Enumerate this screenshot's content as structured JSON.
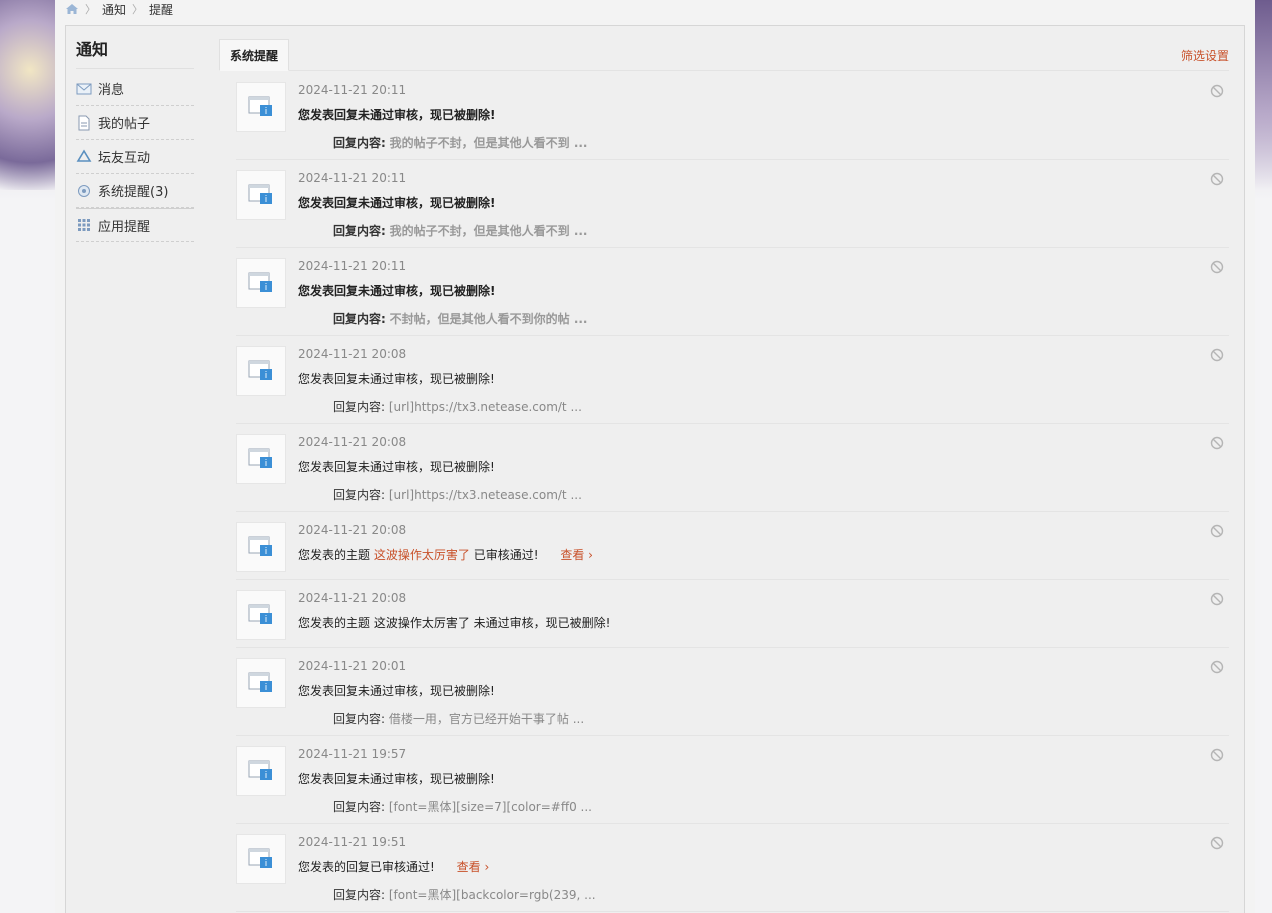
{
  "breadcrumb": {
    "items": [
      "通知",
      "提醒"
    ]
  },
  "sidebar": {
    "title": "通知",
    "items": [
      {
        "label": "消息",
        "icon": "envelope-icon"
      },
      {
        "label": "我的帖子",
        "icon": "document-icon"
      },
      {
        "label": "坛友互动",
        "icon": "recycle-icon"
      },
      {
        "label": "系统提醒(3)",
        "icon": "gear-icon"
      },
      {
        "label": "应用提醒",
        "icon": "grid-icon"
      }
    ]
  },
  "main": {
    "tab_label": "系统提醒",
    "filter_label": "筛选设置"
  },
  "notifications": [
    {
      "time": "2024-11-21 20:11",
      "title": "您发表回复未通过审核，现已被删除!",
      "reply_label": "回复内容:",
      "reply_value": "我的帖子不封，但是其他人看不到 ..."
    },
    {
      "time": "2024-11-21 20:11",
      "title": "您发表回复未通过审核，现已被删除!",
      "reply_label": "回复内容:",
      "reply_value": "我的帖子不封，但是其他人看不到 ..."
    },
    {
      "time": "2024-11-21 20:11",
      "title": "您发表回复未通过审核，现已被删除!",
      "reply_label": "回复内容:",
      "reply_value": "不封帖，但是其他人看不到你的帖 ..."
    },
    {
      "time": "2024-11-21 20:08",
      "title": "您发表回复未通过审核，现已被删除!",
      "reply_label": "回复内容:",
      "reply_value": "[url]https://tx3.netease.com/t ..."
    },
    {
      "time": "2024-11-21 20:08",
      "title": "您发表回复未通过审核，现已被删除!",
      "reply_label": "回复内容:",
      "reply_value": "[url]https://tx3.netease.com/t ..."
    },
    {
      "time": "2024-11-21 20:08",
      "title_prefix": "您发表的主题",
      "title_link": "这波操作太厉害了",
      "title_suffix": "已审核通过!",
      "view_label": "查看 ›"
    },
    {
      "time": "2024-11-21 20:08",
      "title": "您发表的主题 这波操作太厉害了 未通过审核，现已被删除!"
    },
    {
      "time": "2024-11-21 20:01",
      "title": "您发表回复未通过审核，现已被删除!",
      "reply_label": "回复内容:",
      "reply_value": "借楼一用，官方已经开始干事了帖 ..."
    },
    {
      "time": "2024-11-21 19:57",
      "title": "您发表回复未通过审核，现已被删除!",
      "reply_label": "回复内容:",
      "reply_value": "[font=黑体][size=7][color=#ff0 ..."
    },
    {
      "time": "2024-11-21 19:51",
      "title": "您发表的回复已审核通过!",
      "view_label": "查看 ›",
      "reply_label": "回复内容:",
      "reply_value": "[font=黑体][backcolor=rgb(239, ..."
    }
  ],
  "colors": {
    "accent": "#c8512a",
    "muted": "#888888"
  }
}
